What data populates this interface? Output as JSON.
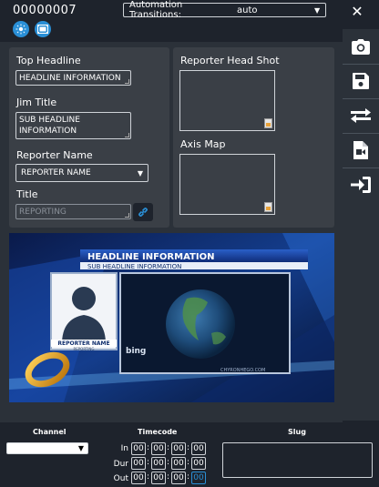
{
  "header": {
    "item_id": "00000007",
    "automation_label": "Automation Transitions:",
    "automation_value": "auto",
    "close_glyph": "✕"
  },
  "colors": {
    "accent_blue": "#2a8fd6",
    "panel_bg": "#3a3f46",
    "window_bg": "#1e232c"
  },
  "toolbar_icons": [
    "sun-icon",
    "film-icon"
  ],
  "sidebar": {
    "buttons": [
      "camera-icon",
      "save-icon",
      "swap-icon",
      "video-file-icon",
      "sign-in-icon"
    ]
  },
  "form": {
    "top_headline_label": "Top Headline",
    "top_headline_value": "HEADLINE INFORMATION",
    "jim_title_label": "Jim Title",
    "jim_title_value": "SUB HEADLINE INFORMATION",
    "reporter_name_label": "Reporter Name",
    "reporter_name_value": "REPORTER NAME",
    "title_label": "Title",
    "title_value": "REPORTING"
  },
  "media": {
    "head_shot_label": "Reporter Head Shot",
    "axis_map_label": "Axis Map"
  },
  "preview": {
    "headline": "HEADLINE INFORMATION",
    "subheadline": "SUB HEADLINE INFORMATION",
    "reporter_name": "REPORTER NAME",
    "reporter_title": "REPORTING",
    "bing": "bing",
    "watermark": "CHYRONHEGO.COM"
  },
  "bottom": {
    "channel_label": "Channel",
    "timecode_label": "Timecode",
    "slug_label": "Slug",
    "rows": [
      {
        "label": "In",
        "values": [
          "00",
          "00",
          "00",
          "00"
        ]
      },
      {
        "label": "Dur",
        "values": [
          "00",
          "00",
          "00",
          "00"
        ]
      },
      {
        "label": "Out",
        "values": [
          "00",
          "00",
          "00",
          "00"
        ]
      }
    ]
  }
}
